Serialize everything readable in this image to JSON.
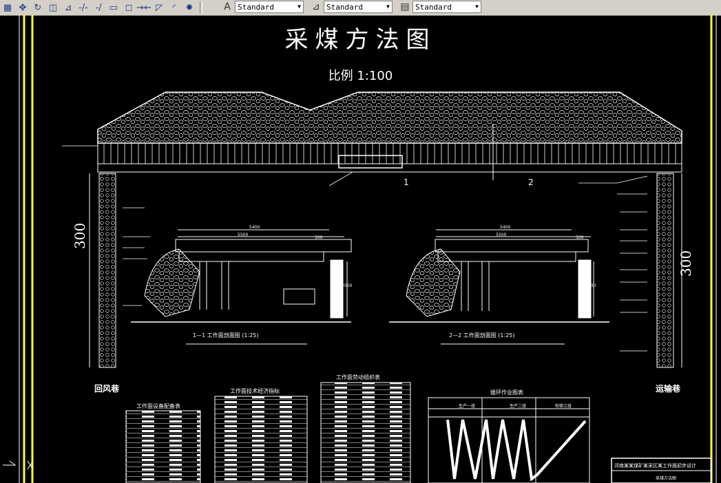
{
  "toolbar": {
    "text_style": "Standard",
    "dim_style": "Standard",
    "table_style": "Standard"
  },
  "drawing": {
    "title": "采煤方法图",
    "scale": "比例  1:100",
    "section_markers": [
      "1",
      "2"
    ],
    "left_height": "300",
    "right_height": "300",
    "left_roadway": "回风巷",
    "right_roadway": "运输巷",
    "section1_caption": "1—1  工作面剖面图 (1:25)",
    "section2_caption": "2—2  工作面剖面图 (1:25)",
    "dim_5400_a": "5400",
    "dim_5500_a": "5500",
    "dim_500_a": "500",
    "dim_2500_a": "2500",
    "dim_5400_b": "5400",
    "dim_5500_b": "5500",
    "dim_500_b": "500",
    "dim_2500_b": "2500",
    "table1_title": "工作面设备配备表",
    "table2_title": "工作面技术经济指标",
    "table3_title": "工作面劳动组织表",
    "chart_title": "循环作业图表",
    "chart_headers": [
      "生产一班",
      "生产二班",
      "检修三班"
    ],
    "title_block_text": "河南某某煤矿某采区某工作面初步设计",
    "title_block_sub": "采煤方法图"
  }
}
